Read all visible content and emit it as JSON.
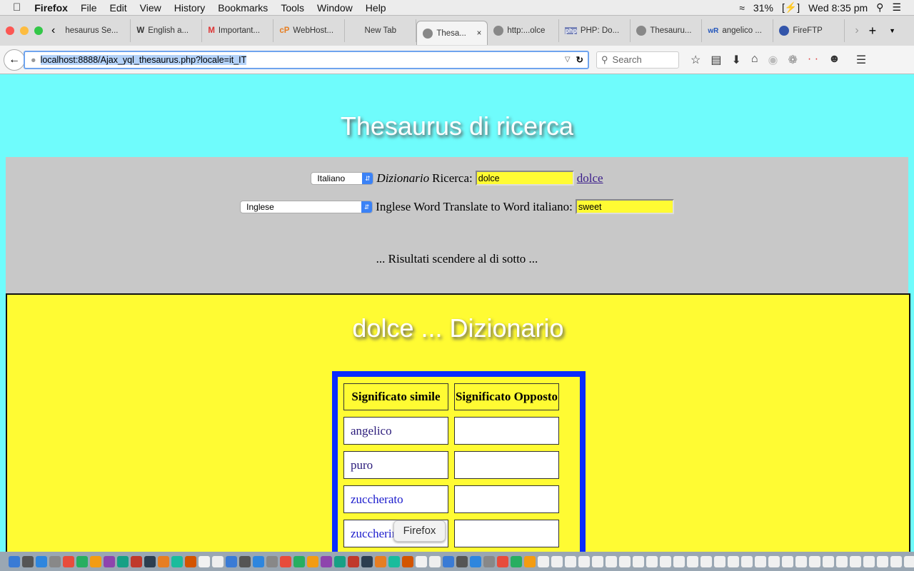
{
  "menubar": {
    "app": "Firefox",
    "items": [
      "File",
      "Edit",
      "View",
      "History",
      "Bookmarks",
      "Tools",
      "Window",
      "Help"
    ],
    "battery": "31%",
    "clock": "Wed 8:35 pm"
  },
  "tabs": [
    {
      "label": "hesaurus Se..."
    },
    {
      "label": "English a...",
      "icon": "W"
    },
    {
      "label": "Important...",
      "icon": "M"
    },
    {
      "label": "WebHost...",
      "icon": "cP"
    },
    {
      "label": "New Tab"
    },
    {
      "label": "Thesa...",
      "active": true
    },
    {
      "label": "http:...olce"
    },
    {
      "label": "PHP: Do...",
      "icon": "php"
    },
    {
      "label": "Thesauru..."
    },
    {
      "label": "angelico ...",
      "icon": "wR"
    },
    {
      "label": "FireFTP"
    }
  ],
  "navbar": {
    "url": "localhost:8888/Ajax_yql_thesaurus.php?locale=it_IT",
    "search_placeholder": "Search"
  },
  "page": {
    "title": "Thesaurus di ricerca",
    "row1": {
      "select": "Italiano",
      "label_italic": "Dizionario",
      "label": "Ricerca:",
      "input": "dolce",
      "link": "dolce"
    },
    "row2": {
      "select": "Inglese",
      "label": "Inglese Word Translate to Word italiano:",
      "input": "sweet"
    },
    "status": "... Risultati scendere al di sotto ...",
    "results_title": "dolce ... Dizionario",
    "table": {
      "headers": [
        "Significato simile",
        "Significato Opposto"
      ],
      "rows": [
        [
          "angelico",
          ""
        ],
        [
          "puro",
          ""
        ],
        [
          "zuccherato",
          ""
        ],
        [
          "zuccherino",
          ""
        ]
      ]
    }
  },
  "tooltip": "Firefox",
  "colors": {
    "page_bg": "#6ffcfc",
    "form_bg": "#c8c8c8",
    "results_bg": "#fffb33",
    "table_border": "#0a2bff"
  }
}
